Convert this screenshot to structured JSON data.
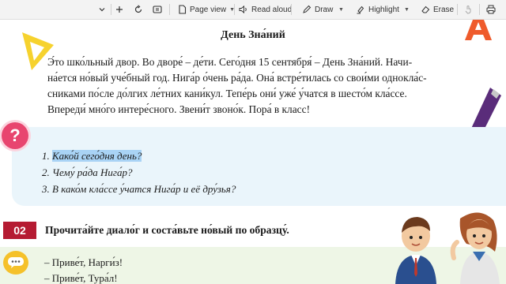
{
  "toolbar": {
    "page_view": "Page view",
    "read_aloud": "Read aloud",
    "draw": "Draw",
    "highlight": "Highlight",
    "erase": "Erase"
  },
  "colors": {
    "highlight": "#a9d3f5",
    "question_box": "#eaf5fb",
    "number_badge": "#b51b32",
    "question_icon": "#e8456f"
  },
  "icons": [
    "chevron-down-icon",
    "zoom-out-icon",
    "zoom-in-icon",
    "rotate-icon",
    "fit-page-icon",
    "page-view-icon",
    "read-aloud-icon",
    "draw-icon",
    "highlight-icon",
    "eraser-icon",
    "touch-icon",
    "print-icon"
  ],
  "lesson": {
    "title": "День Зна́ний",
    "paragraph": [
      "Э́то шко́льный двор. Во дворе́ – де́ти. Сего́дня 15 сентября́ – День Зна́ний. Начи-",
      "на́ется но́вый уче́бный год. Нига́р о́чень ра́да. Она́ встре́тилась со свои́ми однокла́с-",
      "сниками по́сле до́лгих ле́тних кани́кул. Тепе́рь они́ уже́ у́чатся в шесто́м кла́ссе.",
      "Впереди́ мно́го интере́сного. Звени́т звоно́к. Пора́ в класс!"
    ],
    "questions": {
      "q1_number": "1.",
      "q1_text": "Како́й сего́дня день?",
      "q2": "2. Чему́ ра́да Нига́р?",
      "q3": "3. В како́м кла́ссе у́чатся Нига́р и её дру́зья?"
    },
    "task_number": "02",
    "task_text": "Прочита́йте диало́г и соста́вьте но́вый по образцу́.",
    "dialog": [
      "– Приве́т, Нарги́з!",
      "– Приве́т, Тура́л!"
    ]
  }
}
